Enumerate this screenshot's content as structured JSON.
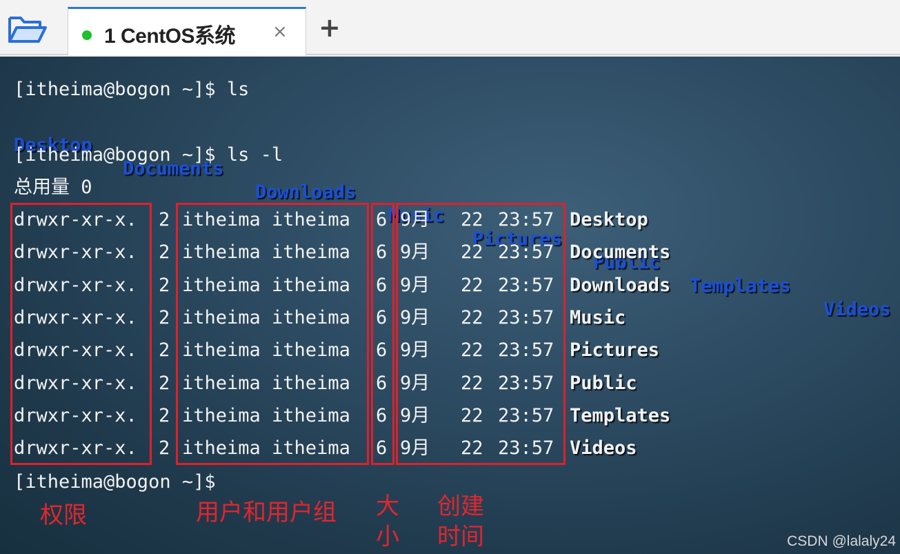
{
  "toolbar": {
    "folder_icon": "folder-open-icon"
  },
  "tabs": [
    {
      "title": "1 CentOS系统",
      "status_color": "#1fbf2d",
      "close_label": "×"
    }
  ],
  "new_tab_label": "+",
  "terminal": {
    "cmd1": "[itheima@bogon ~]$ ls",
    "ls_items": [
      "Desktop",
      "Documents",
      "Downloads",
      "Music",
      "Pictures",
      "Public",
      "Templates",
      "Videos"
    ],
    "cmd2": "[itheima@bogon ~]$ ls -l",
    "total": "总用量 0",
    "rows": [
      {
        "perm": "drwxr-xr-x.",
        "links": "2",
        "owner": "itheima itheima",
        "size": "6",
        "month": "9月",
        "day": "22",
        "time": "23:57",
        "name": "Desktop"
      },
      {
        "perm": "drwxr-xr-x.",
        "links": "2",
        "owner": "itheima itheima",
        "size": "6",
        "month": "9月",
        "day": "22",
        "time": "23:57",
        "name": "Documents"
      },
      {
        "perm": "drwxr-xr-x.",
        "links": "2",
        "owner": "itheima itheima",
        "size": "6",
        "month": "9月",
        "day": "22",
        "time": "23:57",
        "name": "Downloads"
      },
      {
        "perm": "drwxr-xr-x.",
        "links": "2",
        "owner": "itheima itheima",
        "size": "6",
        "month": "9月",
        "day": "22",
        "time": "23:57",
        "name": "Music"
      },
      {
        "perm": "drwxr-xr-x.",
        "links": "2",
        "owner": "itheima itheima",
        "size": "6",
        "month": "9月",
        "day": "22",
        "time": "23:57",
        "name": "Pictures"
      },
      {
        "perm": "drwxr-xr-x.",
        "links": "2",
        "owner": "itheima itheima",
        "size": "6",
        "month": "9月",
        "day": "22",
        "time": "23:57",
        "name": "Public"
      },
      {
        "perm": "drwxr-xr-x.",
        "links": "2",
        "owner": "itheima itheima",
        "size": "6",
        "month": "9月",
        "day": "22",
        "time": "23:57",
        "name": "Templates"
      },
      {
        "perm": "drwxr-xr-x.",
        "links": "2",
        "owner": "itheima itheima",
        "size": "6",
        "month": "9月",
        "day": "22",
        "time": "23:57",
        "name": "Videos"
      }
    ],
    "prompt": "[itheima@bogon ~]$"
  },
  "annotations": {
    "perm": "权限",
    "owner": "用户和用户组",
    "size_1": "大",
    "size_2": "小",
    "time_1": "创建",
    "time_2": "时间"
  },
  "watermark": "CSDN @lalaly24",
  "colors": {
    "directory": "#1b4fd8",
    "annotation": "#e3252d",
    "tab_accent": "#2a78d5"
  }
}
